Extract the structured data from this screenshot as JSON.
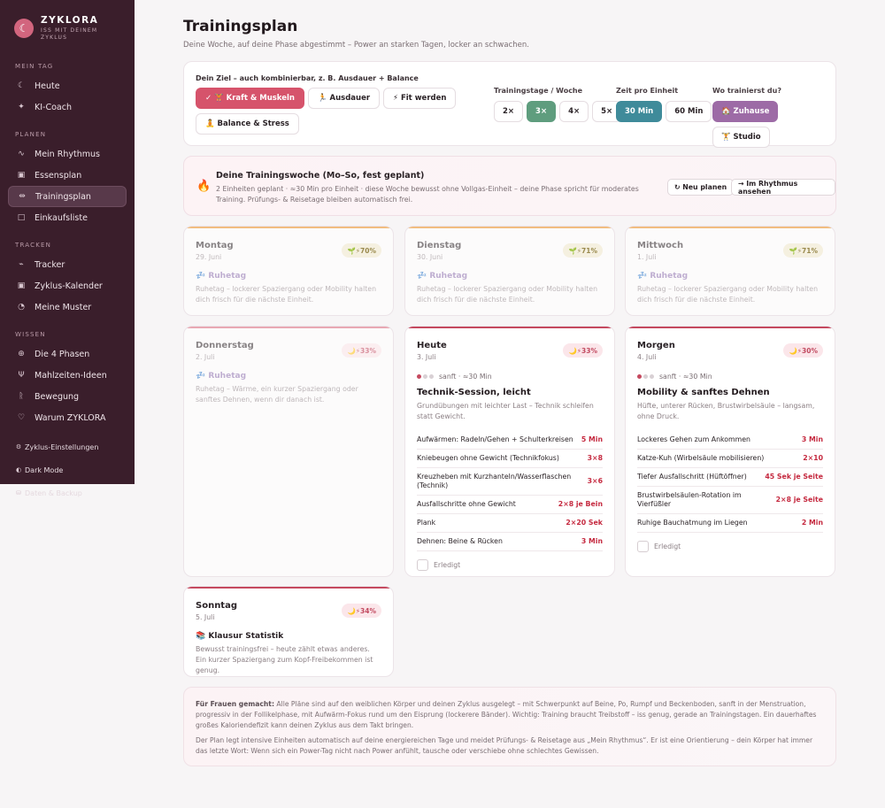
{
  "brand": {
    "name": "ZYKLORA",
    "tagline_1": "ISS MIT DEINEM",
    "tagline_2": "ZYKLUS",
    "logo_icon": "moon-icon"
  },
  "sidebar": {
    "section_today": "MEIN TAG",
    "today_items": [
      {
        "label": "Heute",
        "icon": "moon-icon"
      },
      {
        "label": "KI-Coach",
        "icon": "sparkle-icon"
      }
    ],
    "section_plan": "PLANEN",
    "plan_items": [
      {
        "label": "Mein Rhythmus",
        "icon": "pulse-icon"
      },
      {
        "label": "Essensplan",
        "icon": "calendar-icon"
      },
      {
        "label": "Trainingsplan",
        "icon": "dumbbell-icon",
        "active": true
      },
      {
        "label": "Einkaufsliste",
        "icon": "bag-icon"
      }
    ],
    "section_track": "TRACKEN",
    "track_items": [
      {
        "label": "Tracker",
        "icon": "chart-icon"
      },
      {
        "label": "Zyklus-Kalender",
        "icon": "calendar-icon"
      },
      {
        "label": "Meine Muster",
        "icon": "bulb-icon"
      }
    ],
    "section_know": "WISSEN",
    "know_items": [
      {
        "label": "Die 4 Phasen",
        "icon": "globe-icon"
      },
      {
        "label": "Mahlzeiten-Ideen",
        "icon": "utensils-icon"
      },
      {
        "label": "Bewegung",
        "icon": "runner-icon"
      },
      {
        "label": "Warum ZYKLORA",
        "icon": "heart-icon"
      }
    ],
    "settings": "Zyklus-Einstellungen",
    "dark_mode": "Dark Mode",
    "backup": "Daten & Backup"
  },
  "header": {
    "title": "Trainingsplan",
    "subtitle": "Deine Woche, auf deine Phase abgestimmt – Power an starken Tagen, locker an schwachen."
  },
  "goal": {
    "label": "Dein Ziel – auch kombinierbar, z. B. Ausdauer + Balance",
    "options": [
      "✓ 🏋 Kraft & Muskeln",
      "🏃 Ausdauer",
      "⚡ Fit werden",
      "🧘 Balance & Stress"
    ],
    "days_label": "Trainingstage / Woche",
    "days_options": [
      "2×",
      "3×",
      "4×",
      "5×"
    ],
    "time_label": "Zeit pro Einheit",
    "time_options": [
      "30 Min",
      "60 Min"
    ],
    "place_label": "Wo trainierst du?",
    "place_options": [
      "🏠 Zuhause",
      "🏋 Studio"
    ]
  },
  "week": {
    "title": "Deine Trainingswoche (Mo–So, fest geplant)",
    "text": "2 Einheiten geplant · ≈30 Min pro Einheit · diese Woche bewusst ohne Vollgas-Einheit – deine Phase spricht für moderates Training. Prüfungs- & Reisetage bleiben automatisch frei.",
    "btn_replan": "↻ Neu planen",
    "btn_rhythm": "→ Im Rhythmus ansehen"
  },
  "days": {
    "mon": {
      "name": "Montag",
      "date": "29. Juni",
      "badge": "🌱⚡70%",
      "rest_title": "💤 Ruhetag",
      "rest_text": "Ruhetag – lockerer Spaziergang oder Mobility halten dich frisch für die nächste Einheit."
    },
    "tue": {
      "name": "Dienstag",
      "date": "30. Juni",
      "badge": "🌱⚡71%",
      "rest_title": "💤 Ruhetag",
      "rest_text": "Ruhetag – lockerer Spaziergang oder Mobility halten dich frisch für die nächste Einheit."
    },
    "wed": {
      "name": "Mittwoch",
      "date": "1. Juli",
      "badge": "🌱⚡71%",
      "rest_title": "💤 Ruhetag",
      "rest_text": "Ruhetag – lockerer Spaziergang oder Mobility halten dich frisch für die nächste Einheit."
    },
    "thu": {
      "name": "Donnerstag",
      "date": "2. Juli",
      "badge": "🌙⚡33%",
      "rest_title": "💤 Ruhetag",
      "rest_text": "Ruhetag – Wärme, ein kurzer Spaziergang oder sanftes Dehnen, wenn dir danach ist."
    },
    "today": {
      "name": "Heute",
      "date": "3. Juli",
      "badge": "🌙⚡33%",
      "intensity": "sanft · ≈30 Min",
      "title": "Technik-Session, leicht",
      "text": "Grundübungen mit leichter Last – Technik schleifen statt Gewicht.",
      "exercises": [
        {
          "name": "Aufwärmen: Radeln/Gehen + Schulterkreisen",
          "value": "5 Min"
        },
        {
          "name": "Kniebeugen ohne Gewicht (Technikfokus)",
          "value": "3×8"
        },
        {
          "name": "Kreuzheben mit Kurzhanteln/Wasserflaschen (Technik)",
          "value": "3×6"
        },
        {
          "name": "Ausfallschritte ohne Gewicht",
          "value": "2×8 je Bein"
        },
        {
          "name": "Plank",
          "value": "2×20 Sek"
        },
        {
          "name": "Dehnen: Beine & Rücken",
          "value": "3 Min"
        }
      ],
      "done_label": "Erledigt"
    },
    "tomorrow": {
      "name": "Morgen",
      "date": "4. Juli",
      "badge": "🌙⚡30%",
      "intensity": "sanft · ≈30 Min",
      "title": "Mobility & sanftes Dehnen",
      "text": "Hüfte, unterer Rücken, Brustwirbelsäule – langsam, ohne Druck.",
      "exercises": [
        {
          "name": "Lockeres Gehen zum Ankommen",
          "value": "3 Min"
        },
        {
          "name": "Katze-Kuh (Wirbelsäule mobilisieren)",
          "value": "2×10"
        },
        {
          "name": "Tiefer Ausfallschritt (Hüftöffner)",
          "value": "45 Sek je Seite"
        },
        {
          "name": "Brustwirbelsäulen-Rotation im Vierfüßler",
          "value": "2×8 je Seite"
        },
        {
          "name": "Ruhige Bauchatmung im Liegen",
          "value": "2 Min"
        }
      ],
      "done_label": "Erledigt"
    },
    "sun": {
      "name": "Sonntag",
      "date": "5. Juli",
      "badge": "🌙⚡34%",
      "exam_title": "📚 Klausur Statistik",
      "exam_text": "Bewusst trainingsfrei – heute zählt etwas anderes. Ein kurzer Spaziergang zum Kopf-Freibekommen ist genug."
    }
  },
  "footer": {
    "bold": "Für Frauen gemacht:",
    "text1": "Alle Pläne sind auf den weiblichen Körper und deinen Zyklus ausgelegt – mit Schwerpunkt auf Beine, Po, Rumpf und Beckenboden, sanft in der Menstruation, progressiv in der Follikelphase, mit Aufwärm-Fokus rund um den Eisprung (lockerere Bänder). Wichtig: Training braucht Treibstoff – iss genug, gerade an Trainingstagen. Ein dauerhaftes großes Kaloriendefizit kann deinen Zyklus aus dem Takt bringen.",
    "text2": "Der Plan legt intensive Einheiten automatisch auf deine energiereichen Tage und meidet Prüfungs- & Reisetage aus „Mein Rhythmus“. Er ist eine Orientierung – dein Körper hat immer das letzte Wort: Wenn sich ein Power-Tag nicht nach Power anfühlt, tausche oder verschiebe ohne schlechtes Gewissen."
  },
  "colors": {
    "sidebar_bg": "#3a1e2b",
    "accent_red": "#d6536b",
    "accent_green": "#5f9d7e",
    "accent_teal": "#3f8b9a",
    "accent_purple": "#9d6ba6"
  }
}
